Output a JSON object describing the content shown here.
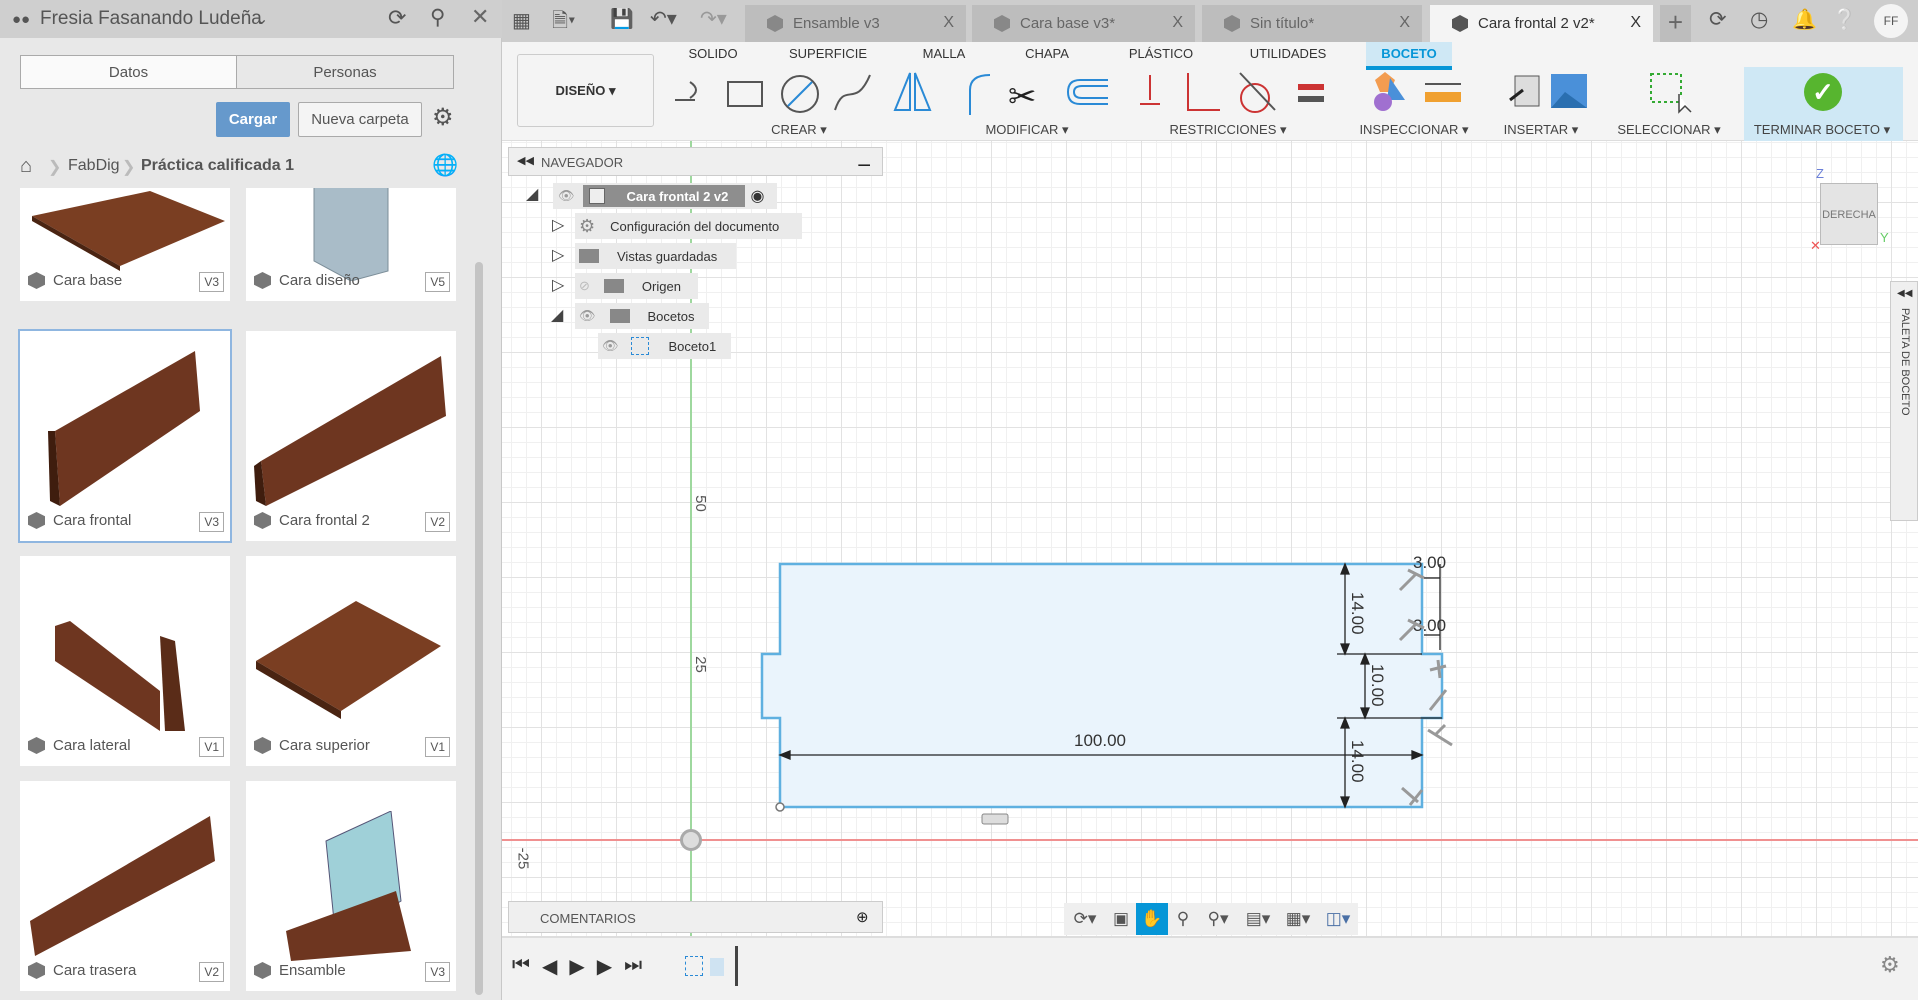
{
  "data_panel": {
    "user": "Fresia Fasanando Ludeña",
    "tabs": [
      "Datos",
      "Personas"
    ],
    "upload": "Cargar",
    "new_folder": "Nueva carpeta",
    "breadcrumb": [
      "FabDig",
      "Práctica calificada 1"
    ],
    "files": [
      {
        "name": "Cara base",
        "version": "V3"
      },
      {
        "name": "Cara diseño",
        "version": "V5"
      },
      {
        "name": "Cara frontal",
        "version": "V3"
      },
      {
        "name": "Cara frontal 2",
        "version": "V2"
      },
      {
        "name": "Cara lateral",
        "version": "V1"
      },
      {
        "name": "Cara superior",
        "version": "V1"
      },
      {
        "name": "Cara trasera",
        "version": "V2"
      },
      {
        "name": "Ensamble",
        "version": "V3"
      }
    ]
  },
  "doc_tabs": [
    {
      "label": "Ensamble v3"
    },
    {
      "label": "Cara base v3*"
    },
    {
      "label": "Sin título*"
    },
    {
      "label": "Cara frontal 2 v2*",
      "active": true
    }
  ],
  "user_initials": "FF",
  "toolbar": {
    "workspace": "DISEÑO",
    "tabs": [
      "SOLIDO",
      "SUPERFICIE",
      "MALLA",
      "CHAPA",
      "PLÁSTICO",
      "UTILIDADES",
      "BOCETO"
    ],
    "active_tab": "BOCETO",
    "groups": [
      "CREAR",
      "MODIFICAR",
      "RESTRICCIONES",
      "INSPECCIONAR",
      "INSERTAR",
      "SELECCIONAR",
      "TERMINAR BOCETO"
    ]
  },
  "navigator": {
    "title": "NAVEGADOR",
    "root": "Cara frontal 2 v2",
    "items": [
      "Configuración del documento",
      "Vistas guardadas",
      "Origen",
      "Bocetos",
      "Boceto1"
    ]
  },
  "viewcube": {
    "face": "DERECHA",
    "axes": [
      "Z",
      "Y"
    ]
  },
  "palette": "PALETA DE BOCETO",
  "axis_labels": [
    "50",
    "25",
    "-25"
  ],
  "dimensions": {
    "width": "100.00",
    "h_top": "14.00",
    "h_mid": "10.00",
    "h_bot": "14.00",
    "d1": "3.00",
    "d2": "3.00"
  },
  "comments": "COMENTARIOS",
  "colors": {
    "accent": "#0696d7",
    "sketch": "#5fb0e0",
    "upload": "#6699cc",
    "finish": "#57b52f"
  }
}
